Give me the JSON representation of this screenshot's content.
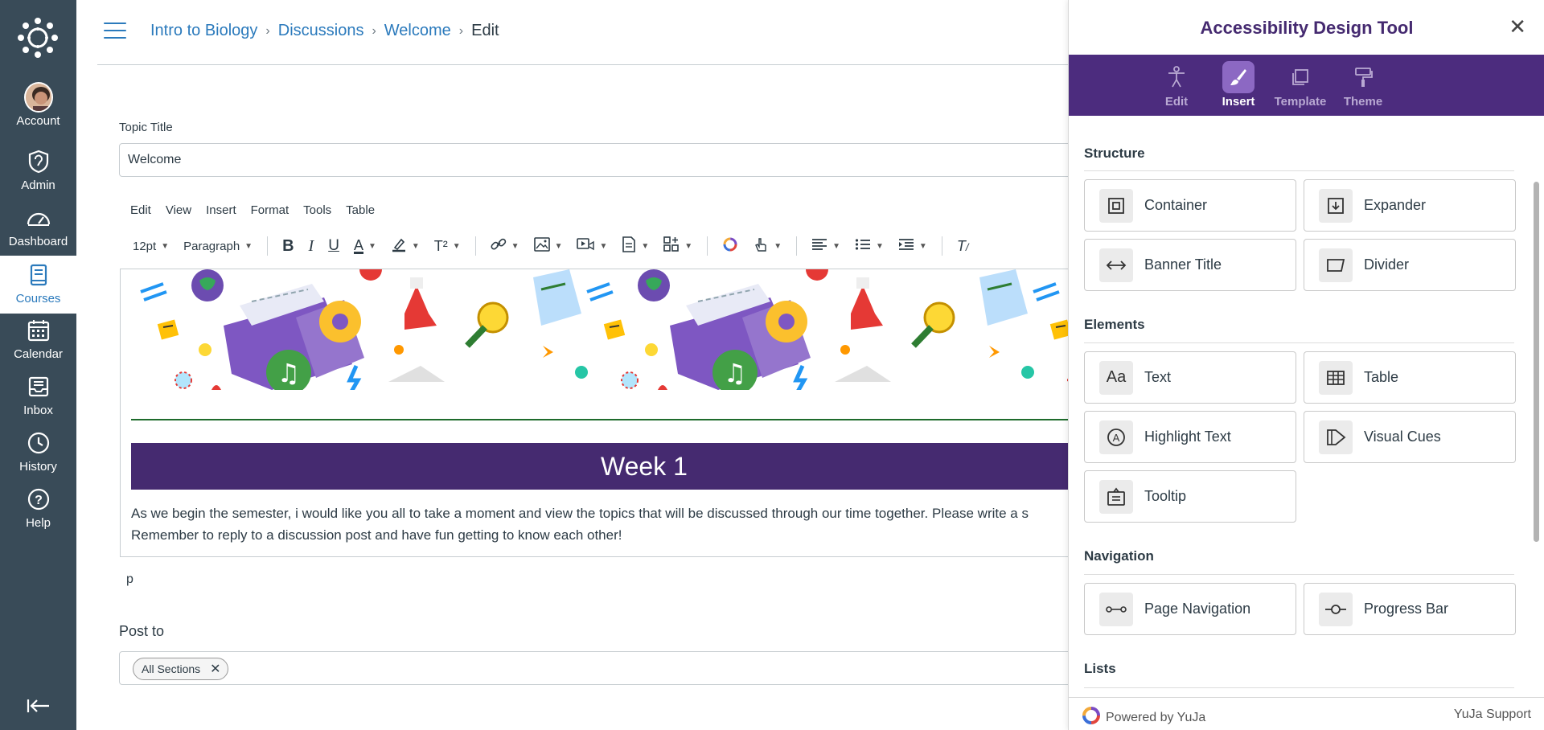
{
  "global_nav": {
    "items": [
      {
        "label": "Account",
        "icon": "avatar"
      },
      {
        "label": "Admin",
        "icon": "shield-icon"
      },
      {
        "label": "Dashboard",
        "icon": "gauge-icon"
      },
      {
        "label": "Courses",
        "icon": "book-icon"
      },
      {
        "label": "Calendar",
        "icon": "calendar-icon"
      },
      {
        "label": "Inbox",
        "icon": "inbox-icon"
      },
      {
        "label": "History",
        "icon": "clock-icon"
      },
      {
        "label": "Help",
        "icon": "help-icon"
      }
    ],
    "active": "Courses"
  },
  "breadcrumb": {
    "course": "Intro to Biology",
    "section": "Discussions",
    "page": "Welcome",
    "current": "Edit"
  },
  "form": {
    "topic_title_label": "Topic Title",
    "topic_title_value": "Welcome",
    "menubar": [
      "Edit",
      "View",
      "Insert",
      "Format",
      "Tools",
      "Table"
    ],
    "font_size": "12pt",
    "block_format": "Paragraph",
    "week_heading": "Week 1",
    "body_line1": "As we begin the semester, i would like you all to take a moment and view the topics that will be discussed through our time together. Please write a s",
    "body_line2": "Remember to reply to a discussion post and have fun getting to know each other!",
    "path_tag": "p",
    "post_to_label": "Post to",
    "post_to_chip": "All Sections"
  },
  "panel": {
    "title": "Accessibility Design Tool",
    "tabs": [
      {
        "label": "Edit",
        "icon": "accessibility-icon"
      },
      {
        "label": "Insert",
        "icon": "brush-icon"
      },
      {
        "label": "Template",
        "icon": "template-icon"
      },
      {
        "label": "Theme",
        "icon": "paint-roller-icon"
      }
    ],
    "active_tab": "Insert",
    "sections": {
      "structure": "Structure",
      "elements": "Elements",
      "navigation": "Navigation",
      "lists": "Lists"
    },
    "cards": {
      "container": "Container",
      "expander": "Expander",
      "banner_title": "Banner Title",
      "divider": "Divider",
      "text": "Text",
      "table": "Table",
      "highlight_text": "Highlight Text",
      "visual_cues": "Visual Cues",
      "tooltip": "Tooltip",
      "page_navigation": "Page Navigation",
      "progress_bar": "Progress Bar"
    },
    "footer": {
      "powered": "Powered by YuJa",
      "support": "YuJa Support"
    }
  },
  "colors": {
    "nav_bg": "#394b58",
    "link": "#2b7abc",
    "brand_purple": "#4c2c7e",
    "week_bar": "#452a70"
  }
}
